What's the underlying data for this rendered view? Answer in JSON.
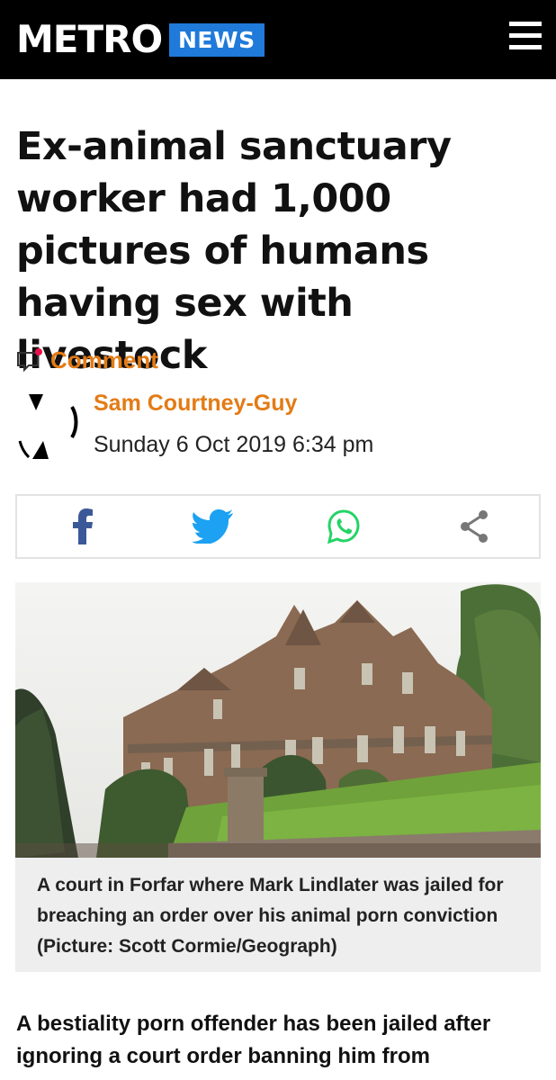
{
  "header": {
    "logo": "METRO",
    "section_badge": "NEWS",
    "menu_icon": "hamburger-menu-icon"
  },
  "article": {
    "headline": "Ex-animal sanctuary worker had 1,000 pictures of humans having sex with livestock",
    "comment_label": "Comment",
    "author": "Sam Courtney-Guy",
    "date": "Sunday 6 Oct 2019 6:34 pm",
    "image_caption": "A court in Forfar where Mark Lindlater was jailed for breaching an order over his animal porn conviction  (Picture: Scott Cormie/Geograph)",
    "lead": "A bestiality porn offender has been jailed after ignoring a court order banning him from"
  },
  "share": {
    "buttons": [
      "facebook-icon",
      "twitter-icon",
      "whatsapp-icon",
      "share-icon"
    ]
  },
  "colors": {
    "topbar": "#000000",
    "badge": "#1f7ad9",
    "accent": "#e37b16",
    "facebook": "#3b5998",
    "twitter": "#1da1f2",
    "whatsapp": "#25d366",
    "share": "#777777"
  }
}
